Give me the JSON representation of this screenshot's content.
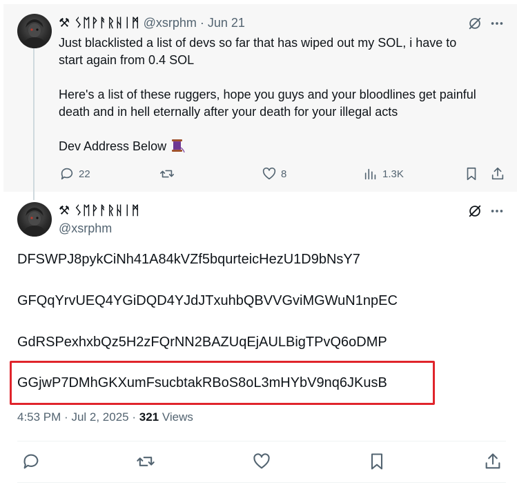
{
  "tweet1": {
    "display_name": "⚒ ᛊᛖᚹᚨᚱᚺᛁᛗ",
    "handle": "@xsrphm",
    "separator": "·",
    "date": "Jun 21",
    "text_lines": [
      "Just blacklisted a list of devs so far that has wiped out my SOL, i have to",
      "start again from 0.4 SOL",
      "",
      "Here's a list of these ruggers, hope you guys and your bloodlines get painful",
      "death and in hell eternally after your death for your illegal acts",
      "",
      "Dev Address Below"
    ],
    "spool_emoji": "spool-of-thread-icon",
    "stats": {
      "replies": "22",
      "retweets": "",
      "likes": "8",
      "views": "1.3K"
    }
  },
  "tweet2": {
    "display_name": "⚒ ᛊᛖᚹᚨᚱᚺᛁᛗ",
    "handle": "@xsrphm",
    "addresses": [
      "DFSWPJ8pykCiNh41A84kVZf5bqurteicHezU1D9bNsY7",
      "GFQqYrvUEQ4YGiDQD4YJdJTxuhbQBVVGviMGWuN1npEC",
      "GdRSPexhxbQz5H2zFQrNN2BAZUqEjAULBigTPvQ6oDMP",
      "GGjwP7DMhGKXumFsucbtakRBoS8oL3mHYbV9nq6JKusB"
    ],
    "time": "4:53 PM",
    "date": "Jul 2, 2025",
    "views_count": "321",
    "views_label": "Views"
  },
  "colors": {
    "muted": "#536471",
    "text": "#0f1419",
    "highlight": "#e0242b",
    "background_top": "#f7f7f7"
  }
}
